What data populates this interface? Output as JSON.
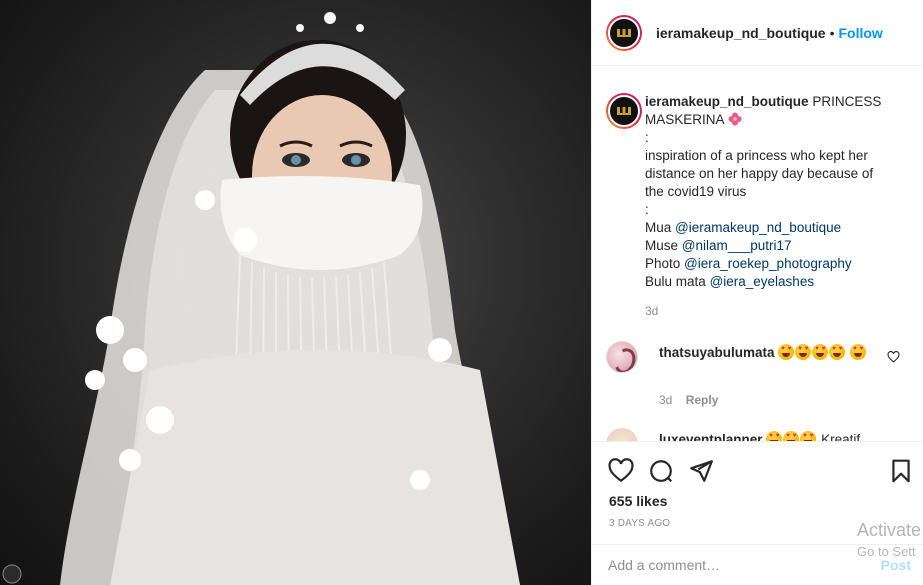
{
  "post": {
    "username": "ieramakeup_nd_boutique",
    "separator": "•",
    "follow_label": "Follow",
    "image_alt": "bride wearing lace veil, tiara and beaded face mask"
  },
  "caption": {
    "username": "ieramakeup_nd_boutique",
    "title": "PRINCESS MASKERINA",
    "title_emoji": "hibiscus-icon",
    "lines": [
      ":",
      "inspiration of a princess who kept her distance on her happy day because of the covid19 virus",
      ":"
    ],
    "credits": [
      {
        "label": "Mua",
        "mention": "@ieramakeup_nd_boutique"
      },
      {
        "label": "Muse",
        "mention": "@nilam___putri17"
      },
      {
        "label": "Photo",
        "mention": "@iera_roekep_photography"
      },
      {
        "label": "Bulu mata",
        "mention": "@iera_eyelashes"
      }
    ],
    "time": "3d"
  },
  "comments": [
    {
      "username": "thatsuyabulumata",
      "emoji_count": 5,
      "time": "3d",
      "reply_label": "Reply"
    },
    {
      "username": "luxeventplanner",
      "emoji_count": 3,
      "text": "Kreatif"
    }
  ],
  "actions": {
    "likes": "655 likes",
    "time_ago": "3 DAYS AGO"
  },
  "add_comment": {
    "placeholder": "Add a comment…",
    "post_label": "Post"
  },
  "watermark": {
    "line1": "Activate",
    "line2": "Go to Sett"
  },
  "colors": {
    "accent": "#0095f6",
    "mention": "#00376b",
    "muted": "#8e8e8e",
    "post_disabled": "#b2dffc"
  }
}
